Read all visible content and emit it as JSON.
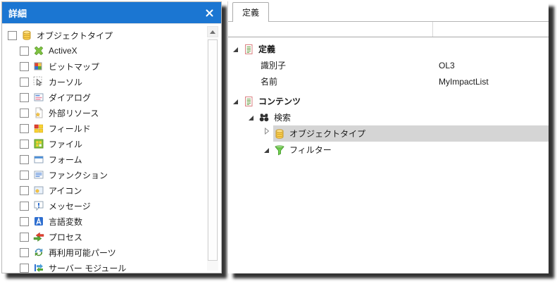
{
  "colors": {
    "titlebar": "#1B76D2",
    "titlebar_text": "#FFFFFF",
    "selection": "#D5D5D5"
  },
  "left_panel": {
    "title": "詳細",
    "items": [
      {
        "label": "オブジェクトタイプ",
        "icon": "database-icon",
        "level": 0,
        "checked": false
      },
      {
        "label": "ActiveX",
        "icon": "activex-icon",
        "level": 1,
        "checked": false
      },
      {
        "label": "ビットマップ",
        "icon": "bitmap-icon",
        "level": 1,
        "checked": false
      },
      {
        "label": "カーソル",
        "icon": "cursor-icon",
        "level": 1,
        "checked": false
      },
      {
        "label": "ダイアログ",
        "icon": "dialog-icon",
        "level": 1,
        "checked": false
      },
      {
        "label": "外部リソース",
        "icon": "external-resource-icon",
        "level": 1,
        "checked": false
      },
      {
        "label": "フィールド",
        "icon": "field-icon",
        "level": 1,
        "checked": false
      },
      {
        "label": "ファイル",
        "icon": "file-icon",
        "level": 1,
        "checked": false
      },
      {
        "label": "フォーム",
        "icon": "form-icon",
        "level": 1,
        "checked": false
      },
      {
        "label": "ファンクション",
        "icon": "function-icon",
        "level": 1,
        "checked": false
      },
      {
        "label": "アイコン",
        "icon": "picture-icon",
        "level": 1,
        "checked": false
      },
      {
        "label": "メッセージ",
        "icon": "message-icon",
        "level": 1,
        "checked": false
      },
      {
        "label": "言語変数",
        "icon": "language-variable-icon",
        "level": 1,
        "checked": false
      },
      {
        "label": "プロセス",
        "icon": "process-icon",
        "level": 1,
        "checked": false
      },
      {
        "label": "再利用可能パーツ",
        "icon": "reusable-part-icon",
        "level": 1,
        "checked": false
      },
      {
        "label": "サーバー モジュール",
        "icon": "server-module-icon",
        "level": 1,
        "checked": false
      }
    ]
  },
  "right_panel": {
    "tab_label": "定義",
    "rows": [
      {
        "type": "group",
        "label": "定義",
        "icon": "document-icon",
        "state": "expanded",
        "level": 0
      },
      {
        "type": "prop",
        "label": "識別子",
        "value": "OL3"
      },
      {
        "type": "prop",
        "label": "名前",
        "value": "MyImpactList"
      },
      {
        "type": "group",
        "label": "コンテンツ",
        "icon": "document-icon",
        "state": "expanded",
        "level": 0,
        "gap_before": true
      },
      {
        "type": "node",
        "label": "検索",
        "icon": "binoculars-icon",
        "state": "expanded",
        "level": 1
      },
      {
        "type": "node",
        "label": "オブジェクトタイプ",
        "icon": "database-icon",
        "state": "collapsed",
        "level": 2,
        "selected": true
      },
      {
        "type": "node",
        "label": "フィルター",
        "icon": "funnel-icon",
        "state": "expanded",
        "level": 2
      }
    ]
  }
}
